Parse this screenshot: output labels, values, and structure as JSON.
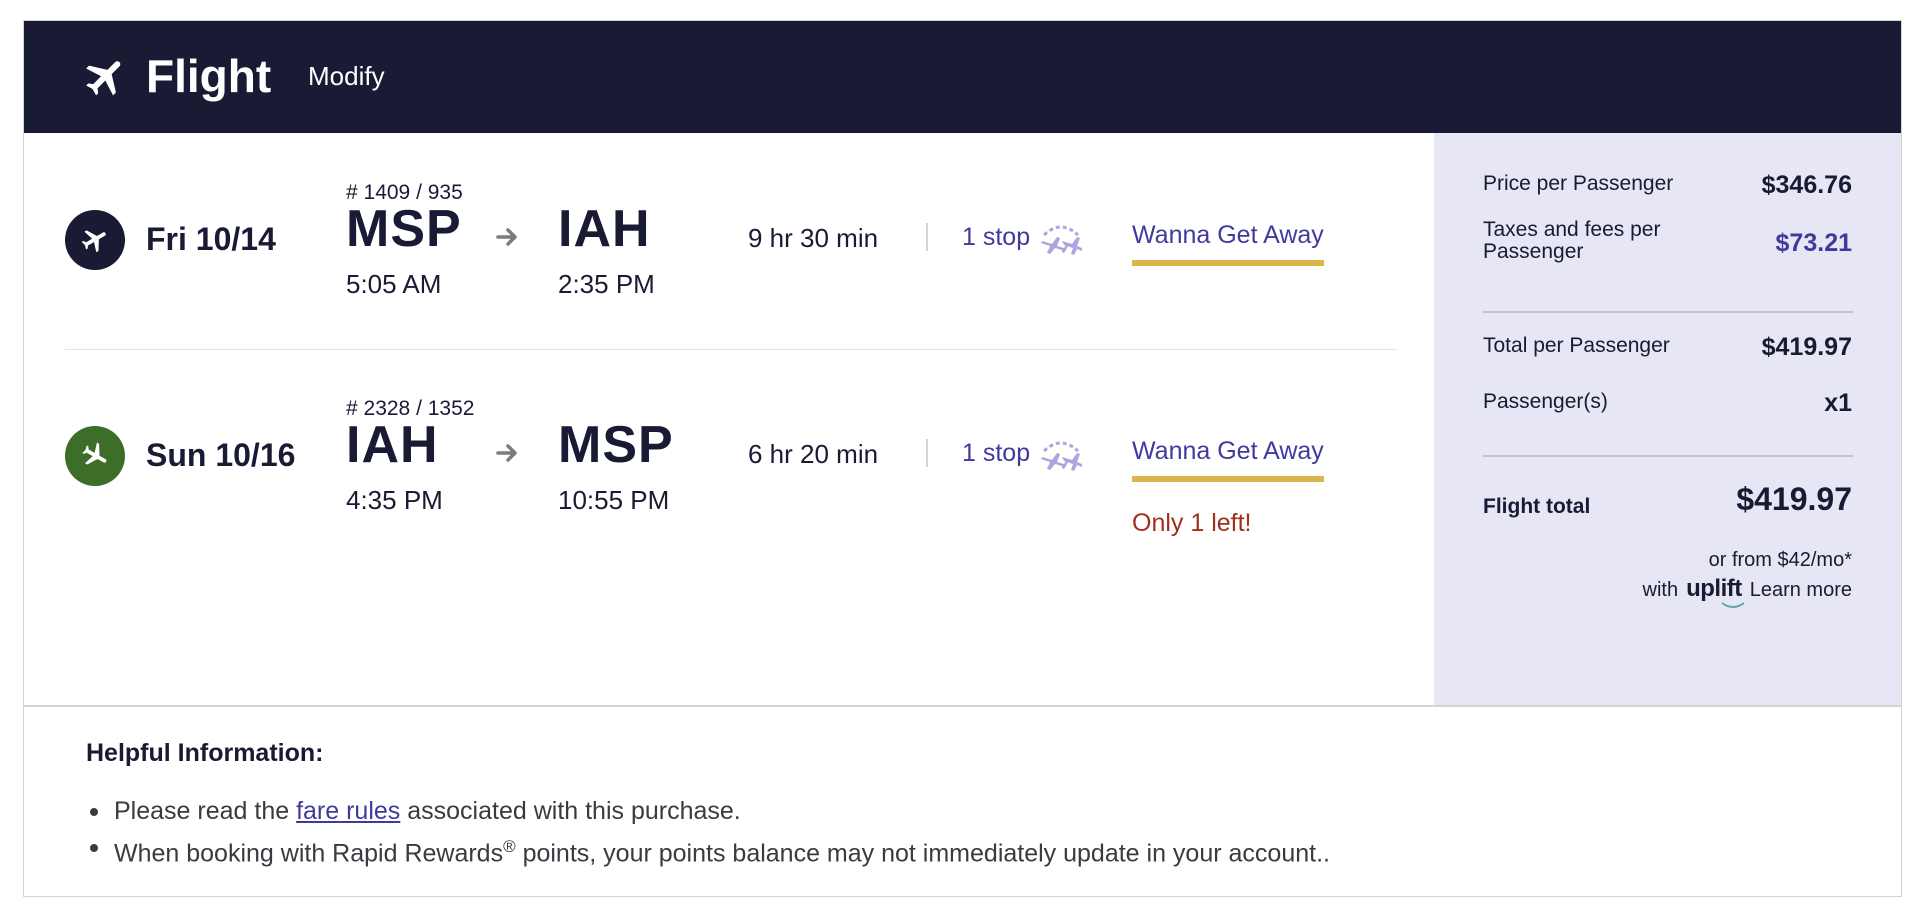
{
  "header": {
    "title": "Flight",
    "modify_label": "Modify",
    "icon": "airplane-icon"
  },
  "flights": [
    {
      "date": "Fri 10/14",
      "flight_numbers": "# 1409 / 935",
      "origin": "MSP",
      "destination": "IAH",
      "departure_time": "5:05 AM",
      "arrival_time": "2:35 PM",
      "duration": "9 hr 30 min",
      "stops": "1 stop",
      "fare_type": "Wanna Get Away",
      "badge_color": "#191a33",
      "icon": "departing-plane-icon"
    },
    {
      "date": "Sun 10/16",
      "flight_numbers": "# 2328 / 1352",
      "origin": "IAH",
      "destination": "MSP",
      "departure_time": "4:35 PM",
      "arrival_time": "10:55 PM",
      "duration": "6 hr 20 min",
      "stops": "1 stop",
      "fare_type": "Wanna Get Away",
      "availability_note": "Only 1 left!",
      "badge_color": "#3c6e2a",
      "icon": "returning-plane-icon"
    }
  ],
  "summary": {
    "price_per_passenger_label": "Price per Passenger",
    "price_per_passenger": "$346.76",
    "taxes_label_line1": "Taxes and fees per",
    "taxes_label_line2": "Passenger",
    "taxes": "$73.21",
    "total_per_passenger_label": "Total per Passenger",
    "total_per_passenger": "$419.97",
    "passengers_label": "Passenger(s)",
    "passengers": "x1",
    "flight_total_label": "Flight total",
    "flight_total": "$419.97",
    "financing_text": "or from $42/mo*",
    "with_text": "with",
    "uplift_brand": "uplift",
    "learn_more": "Learn more"
  },
  "helpful": {
    "title": "Helpful Information:",
    "item1_prefix": "Please read the ",
    "item1_link": "fare rules",
    "item1_suffix": " associated with this purchase.",
    "item2_prefix": "When booking with Rapid Rewards",
    "item2_sup": "®",
    "item2_suffix": " points, your points balance may not immediately update in your account.."
  },
  "colors": {
    "header_bg": "#191a33",
    "accent_purple": "#3f3a9e",
    "fare_underline": "#dab64a",
    "warning_red": "#a0301c",
    "summary_bg": "#e6e6f4"
  }
}
